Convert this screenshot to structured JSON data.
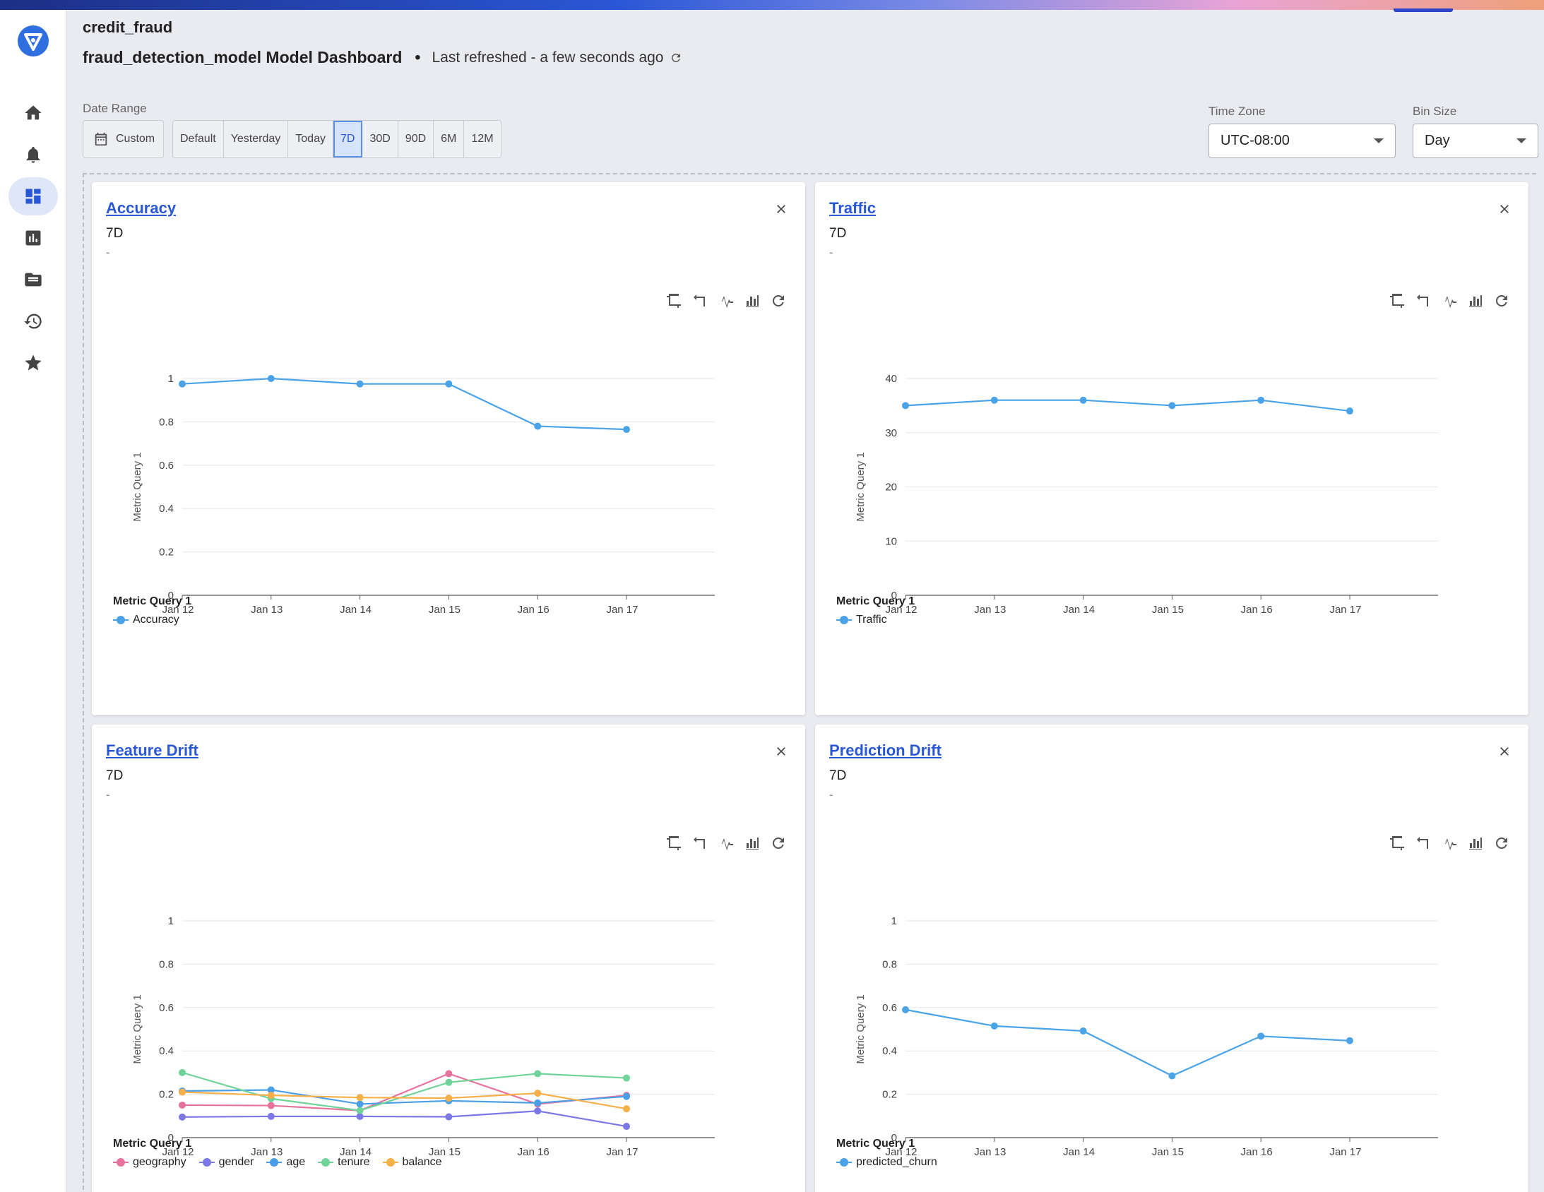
{
  "breadcrumb": "credit_fraud",
  "dashboard": {
    "title": "fraud_detection_model Model Dashboard",
    "refresh_text": "Last refreshed - a few seconds ago"
  },
  "filters": {
    "date_range_label": "Date Range",
    "custom_label": "Custom",
    "range_buttons": [
      "Default",
      "Yesterday",
      "Today",
      "7D",
      "30D",
      "90D",
      "6M",
      "12M"
    ],
    "active_range": "7D",
    "time_zone_label": "Time Zone",
    "time_zone_value": "UTC-08:00",
    "bin_size_label": "Bin Size",
    "bin_size_value": "Day"
  },
  "sidebar": {
    "items": [
      "home-icon",
      "bell-icon",
      "dashboard-icon",
      "bar-chart-icon",
      "folder-icon",
      "history-icon",
      "star-icon"
    ],
    "active": "dashboard-icon"
  },
  "colors": {
    "accent": "#2a57d6",
    "series_blue": "#4aa3e6",
    "geography": "#e8739a",
    "gender": "#7b78e6",
    "age": "#4a9ee6",
    "tenure": "#6fd39a",
    "balance": "#f5b04a"
  },
  "cards": [
    {
      "title": "Accuracy",
      "range": "7D",
      "dash": "-",
      "legend_title": "Metric Query 1",
      "chart_data": {
        "type": "line",
        "x": [
          "Jan 12",
          "Jan 13",
          "Jan 14",
          "Jan 15",
          "Jan 16",
          "Jan 17"
        ],
        "ylabel": "Metric Query 1",
        "ylim": [
          0,
          1
        ],
        "yticks": [
          0,
          0.2,
          0.4,
          0.6,
          0.8,
          1
        ],
        "ytick_labels": [
          "0",
          "0.2",
          "0.4",
          "0.6",
          "0.8",
          "1"
        ],
        "series": [
          {
            "name": "Accuracy",
            "color": "#4aa3e6",
            "values": [
              0.975,
              1.0,
              0.975,
              0.975,
              0.78,
              0.765
            ]
          }
        ]
      }
    },
    {
      "title": "Traffic",
      "range": "7D",
      "dash": "-",
      "legend_title": "Metric Query 1",
      "chart_data": {
        "type": "line",
        "x": [
          "Jan 12",
          "Jan 13",
          "Jan 14",
          "Jan 15",
          "Jan 16",
          "Jan 17"
        ],
        "ylabel": "Metric Query 1",
        "ylim": [
          0,
          40
        ],
        "yticks": [
          0,
          10,
          20,
          30,
          40
        ],
        "ytick_labels": [
          "0",
          "10",
          "20",
          "30",
          "40"
        ],
        "series": [
          {
            "name": "Traffic",
            "color": "#4aa3e6",
            "values": [
              35,
              36,
              36,
              35,
              36,
              34
            ]
          }
        ]
      }
    },
    {
      "title": "Feature Drift",
      "range": "7D",
      "dash": "-",
      "legend_title": "Metric Query 1",
      "chart_data": {
        "type": "line",
        "x": [
          "Jan 12",
          "Jan 13",
          "Jan 14",
          "Jan 15",
          "Jan 16",
          "Jan 17"
        ],
        "ylabel": "Metric Query 1",
        "ylim": [
          0,
          1
        ],
        "yticks": [
          0,
          0.2,
          0.4,
          0.6,
          0.8,
          1
        ],
        "ytick_labels": [
          "0",
          "0.2",
          "0.4",
          "0.6",
          "0.8",
          "1"
        ],
        "series": [
          {
            "name": "geography",
            "color": "#e8739a",
            "values": [
              0.15,
              0.148,
              0.125,
              0.295,
              0.155,
              0.195
            ]
          },
          {
            "name": "gender",
            "color": "#7b78e6",
            "values": [
              0.095,
              0.098,
              0.098,
              0.096,
              0.123,
              0.052
            ]
          },
          {
            "name": "age",
            "color": "#4a9ee6",
            "values": [
              0.215,
              0.22,
              0.155,
              0.17,
              0.16,
              0.19
            ]
          },
          {
            "name": "tenure",
            "color": "#6fd39a",
            "values": [
              0.3,
              0.18,
              0.125,
              0.255,
              0.295,
              0.275
            ]
          },
          {
            "name": "balance",
            "color": "#f5b04a",
            "values": [
              0.21,
              0.195,
              0.185,
              0.182,
              0.205,
              0.133
            ]
          }
        ]
      }
    },
    {
      "title": "Prediction Drift",
      "range": "7D",
      "dash": "-",
      "legend_title": "Metric Query 1",
      "chart_data": {
        "type": "line",
        "x": [
          "Jan 12",
          "Jan 13",
          "Jan 14",
          "Jan 15",
          "Jan 16",
          "Jan 17"
        ],
        "ylabel": "Metric Query 1",
        "ylim": [
          0,
          1
        ],
        "yticks": [
          0,
          0.2,
          0.4,
          0.6,
          0.8,
          1
        ],
        "ytick_labels": [
          "0",
          "0.2",
          "0.4",
          "0.6",
          "0.8",
          "1"
        ],
        "series": [
          {
            "name": "predicted_churn",
            "color": "#4aa3e6",
            "values": [
              0.59,
              0.515,
              0.492,
              0.285,
              0.468,
              0.447
            ]
          }
        ]
      }
    }
  ]
}
